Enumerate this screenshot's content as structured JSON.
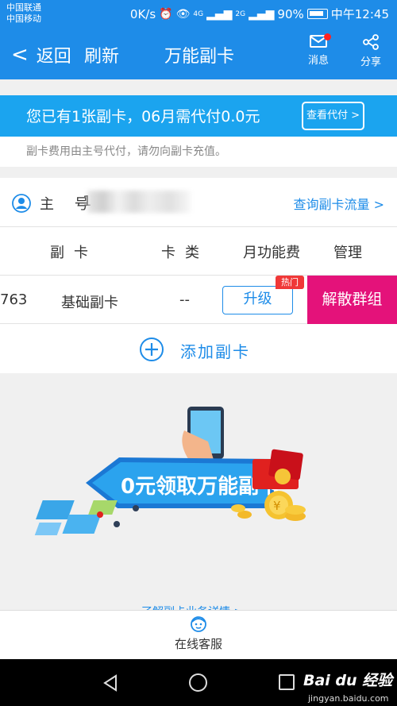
{
  "status_bar": {
    "carrier_1": "中国联通",
    "carrier_2": "中国移动",
    "speed": "0K/s",
    "signal_1": "4G",
    "signal_2": "2G",
    "battery": "90%",
    "time": "中午12:45"
  },
  "nav": {
    "back": "返回",
    "refresh": "刷新",
    "title": "万能副卡",
    "messages": "消息",
    "share": "分享"
  },
  "info": {
    "text": "您已有1张副卡，06月需代付0.0元",
    "button": "查看代付 >",
    "note": "副卡费用由主号代付，请勿向副卡充值。"
  },
  "main_number": {
    "label": "主 号",
    "partial": "1",
    "query_link": "查询副卡流量 >"
  },
  "table": {
    "headers": [
      "副卡",
      "卡类",
      "月功能费",
      "管理"
    ],
    "row": {
      "number": "763",
      "name": "基础副卡",
      "type": "--",
      "upgrade": "升级",
      "hot_badge": "热门",
      "disband": "解散群组"
    }
  },
  "add": {
    "label": "添加副卡"
  },
  "promo": {
    "banner_text": "0元领取万能副卡",
    "learn_more": "了解副卡业务详情 >"
  },
  "bottom": {
    "customer_service": "在线客服"
  },
  "watermark": {
    "brand": "Bai du 经验",
    "url": "jingyan.baidu.com"
  },
  "colors": {
    "primary": "#1e8ce8",
    "band": "#1ba4ef",
    "accent": "#e4127a",
    "hot": "#f03838"
  }
}
